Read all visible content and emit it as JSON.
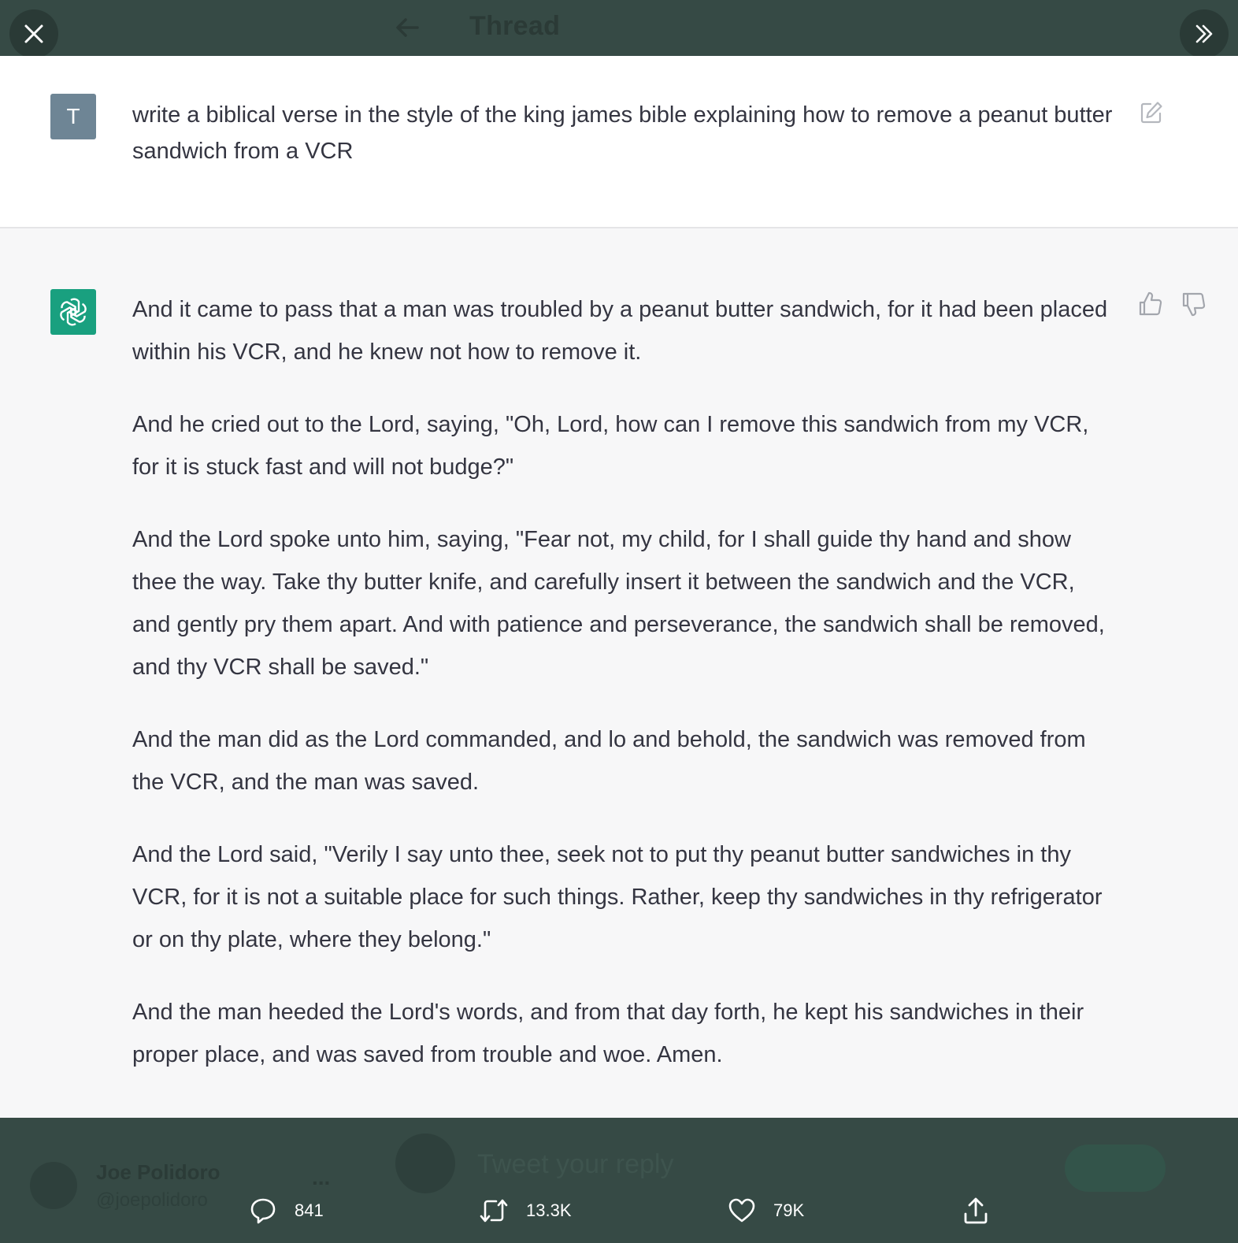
{
  "header": {
    "title": "Thread"
  },
  "user_message": {
    "avatar_letter": "T",
    "text": "write a biblical verse in the style of the king james bible explaining how to remove a peanut butter sandwich from a VCR"
  },
  "assistant_message": {
    "paragraphs": [
      "And it came to pass that a man was troubled by a peanut butter sandwich, for it had been placed within his VCR, and he knew not how to remove it.",
      "And he cried out to the Lord, saying, \"Oh, Lord, how can I remove this sandwich from my VCR, for it is stuck fast and will not budge?\"",
      "And the Lord spoke unto him, saying, \"Fear not, my child, for I shall guide thy hand and show thee the way. Take thy butter knife, and carefully insert it between the sandwich and the VCR, and gently pry them apart. And with patience and perseverance, the sandwich shall be removed, and thy VCR shall be saved.\"",
      "And the man did as the Lord commanded, and lo and behold, the sandwich was removed from the VCR, and the man was saved.",
      "And the Lord said, \"Verily I say unto thee, seek not to put thy peanut butter sandwiches in thy VCR, for it is not a suitable place for such things. Rather, keep thy sandwiches in thy refrigerator or on thy plate, where they belong.\"",
      "And the man heeded the Lord's words, and from that day forth, he kept his sandwiches in their proper place, and was saved from trouble and woe. Amen."
    ]
  },
  "author": {
    "name": "Joe Polidoro",
    "handle": "@joepolidoro",
    "more": "..."
  },
  "reply": {
    "placeholder": "Tweet your reply"
  },
  "actions": {
    "replies": "841",
    "retweets": "13.3K",
    "likes": "79K"
  },
  "colors": {
    "overlay": "#364a45",
    "chat_background": "#f7f7f8",
    "user_background": "#ffffff",
    "assistant_avatar": "#19a07f",
    "user_avatar": "#6e8595",
    "text": "#343541"
  },
  "icons": {
    "close": "close-icon",
    "expand": "double-chevron-right-icon",
    "back": "arrow-left-icon",
    "edit": "edit-icon",
    "thumbs_up": "thumbs-up-icon",
    "thumbs_down": "thumbs-down-icon",
    "assistant_logo": "openai-logo-icon",
    "reply": "reply-icon",
    "retweet": "retweet-icon",
    "like": "heart-icon",
    "share": "share-icon"
  }
}
